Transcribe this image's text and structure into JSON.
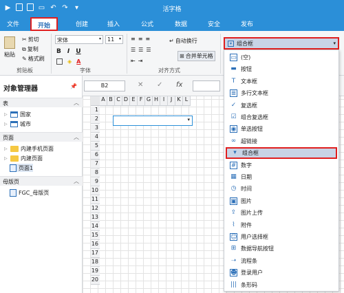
{
  "app": {
    "title": "活字格"
  },
  "menu": [
    "文件",
    "开始",
    "创建",
    "插入",
    "公式",
    "数据",
    "安全",
    "发布"
  ],
  "ribbon": {
    "paste": "粘贴",
    "cut": "剪切",
    "copy": "复制",
    "format_painter": "格式刷",
    "clipboard_label": "剪贴板",
    "font_name": "宋体",
    "font_size": "11",
    "font_label": "字体",
    "align_label": "对齐方式",
    "wrap_text": "自动换行",
    "merge_cells": "合并单元格",
    "bold": "B",
    "italic": "I",
    "underline": "U",
    "font_color": "A",
    "cell_type": "组合框"
  },
  "object_manager": {
    "title": "对象管理器",
    "sections": [
      {
        "label": "表",
        "items": [
          "国家",
          "城市"
        ]
      },
      {
        "label": "页面",
        "items": [
          "内建手机页面",
          "内建页面",
          "页面1"
        ]
      },
      {
        "label": "母版页",
        "items": [
          "FGC_母版页"
        ]
      }
    ]
  },
  "formula_bar": {
    "cell_ref": "B2",
    "cancel": "✕",
    "confirm": "✓",
    "fx": "fx"
  },
  "sheet": {
    "columns": [
      "A",
      "B",
      "C",
      "D",
      "E",
      "F",
      "G",
      "H",
      "I",
      "J",
      "K",
      "L"
    ],
    "rows": [
      "1",
      "2",
      "3",
      "4",
      "5",
      "6",
      "7",
      "8",
      "9",
      "10",
      "11",
      "12",
      "13",
      "14",
      "15",
      "16",
      "17",
      "18",
      "19",
      "20"
    ]
  },
  "celltype_dropdown": {
    "selected": "组合框",
    "items": [
      {
        "label": "(空)",
        "icon": "empty-icon"
      },
      {
        "label": "按钮",
        "icon": "button-icon"
      },
      {
        "label": "文本框",
        "icon": "textbox-icon"
      },
      {
        "label": "多行文本框",
        "icon": "multiline-textbox-icon"
      },
      {
        "label": "复选框",
        "icon": "checkbox-icon"
      },
      {
        "label": "组合复选框",
        "icon": "combo-checkbox-icon"
      },
      {
        "label": "单选按钮",
        "icon": "radio-icon"
      },
      {
        "label": "超链接",
        "icon": "link-icon"
      },
      {
        "label": "组合框",
        "icon": "combobox-icon"
      },
      {
        "label": "数字",
        "icon": "number-icon"
      },
      {
        "label": "日期",
        "icon": "date-icon"
      },
      {
        "label": "时间",
        "icon": "time-icon"
      },
      {
        "label": "图片",
        "icon": "image-icon"
      },
      {
        "label": "图片上传",
        "icon": "image-upload-icon"
      },
      {
        "label": "附件",
        "icon": "attachment-icon"
      },
      {
        "label": "用户选择框",
        "icon": "user-select-icon"
      },
      {
        "label": "数据导航按钮",
        "icon": "data-nav-icon"
      },
      {
        "label": "流程条",
        "icon": "flow-bar-icon"
      },
      {
        "label": "登录用户",
        "icon": "login-user-icon"
      },
      {
        "label": "条形码",
        "icon": "barcode-icon"
      }
    ]
  },
  "colors": {
    "accent": "#2b8fd8",
    "highlight_border": "#e01e1e",
    "selection": "#c8d4e6"
  }
}
